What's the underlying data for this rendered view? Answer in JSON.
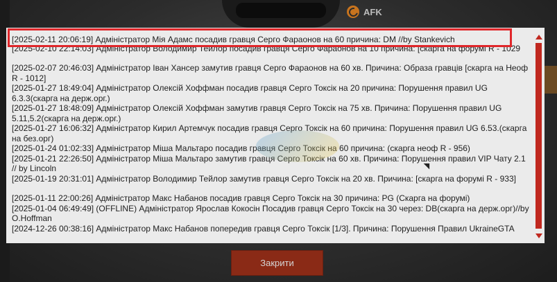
{
  "afk": {
    "label": "AFK",
    "icon": "clock-icon",
    "icon_color": "#c8741e"
  },
  "colors": {
    "accent": "#c0281f",
    "highlight": "#e0262a",
    "button_bg": "#8a2a16",
    "panel_bg": "#ebebeb"
  },
  "log": [
    "[2025-02-11 20:06:19] Адміністратор Мія Адамс посадив гравця Серго Фараонов на 60 причина: DM //by Stankevich",
    "[2025-02-10 22:14:03] Адміністратор Володимир Тейлор посадив гравця Серго Фараонов на 10 причина: [скарга на форумі R - 1029",
    "[2025-02-07 20:46:03] Адміністратор Іван Хансер замутив гравця Серго Фараонов на 60 хв. Причина: Образа гравців [скарга на Неоф R - 1012]",
    "[2025-01-27 18:49:04] Адміністратор Олексій Хоффман посадив гравця Серго Токсік на 20 причина: Порушення правил UG 6.3.3(скарга на держ.орг.)",
    "[2025-01-27 18:48:09] Адміністратор Олексій Хоффман замутив гравця Серго Токсік на 75 хв. Причина: Порушення правил UG 5.11,5.2(скарга на держ.орг.)",
    "[2025-01-27 16:06:32] Адміністратор Кирил Артемчук посадив гравця Серго Токсік на 60 причина: Порушення правил UG 6.53.(скарга на без.орг)",
    "[2025-01-24 01:02:33] Адміністратор Міша Мальтаро посадив гравця Серго Токсік на 60 причина: (скарга неоф R - 956)",
    "[2025-01-21 22:26:50] Адміністратор Міша Мальтаро замутив гравця Серго Токсік на 60 хв. Причина: Порушення правил VIP Чату 2.1 // by Lincoln",
    "[2025-01-19 20:31:01] Адміністратор Володимир Тейлор замутив гравця Серго Токсік на 20 хв. Причина: [скарга на форумі R - 933]",
    "[2025-01-11 22:00:26] Адміністратор Макс Набанов посадив гравця Серго Токсік на 30 причина: PG (Скарга на форумі)",
    "[2025-01-04 06:49:49] (OFFLINE) Адміністратор Ярослав Кокосін Посадив гравця Серго Токсік на 30 через: DB(скарга на держ.орг)//by O.Hoffman",
    "[2024-12-26 00:38:16] Адміністратор Макс Набанов попередив гравця Серго Токсік [1/3]. Причина: Порушення Правил UkraineGTA"
  ],
  "close_button": {
    "label": "Закрити"
  }
}
